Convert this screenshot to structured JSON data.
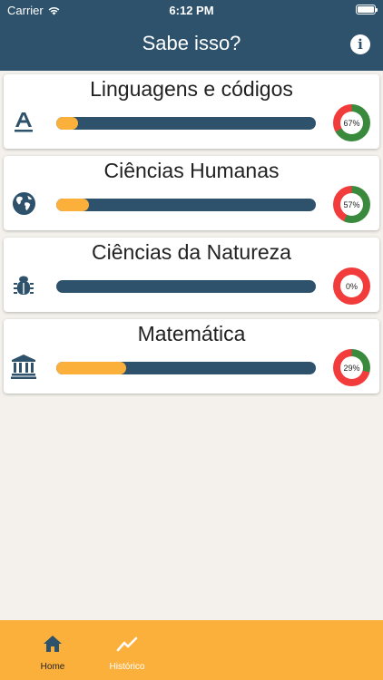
{
  "status_bar": {
    "carrier": "Carrier",
    "time": "6:12 PM"
  },
  "nav": {
    "title": "Sabe isso?",
    "info_icon": "info-icon"
  },
  "subjects": [
    {
      "title": "Linguagens e códigos",
      "icon": "font-icon",
      "progress": 0.085,
      "score_label": "67%",
      "score": 67
    },
    {
      "title": "Ciências Humanas",
      "icon": "globe-icon",
      "progress": 0.125,
      "score_label": "57%",
      "score": 57
    },
    {
      "title": "Ciências da Natureza",
      "icon": "bug-icon",
      "progress": 0.0,
      "score_label": "0%",
      "score": 0
    },
    {
      "title": "Matemática",
      "icon": "bank-icon",
      "progress": 0.27,
      "score_label": "29%",
      "score": 29
    }
  ],
  "tabs": [
    {
      "label": "Home",
      "icon": "home-icon",
      "active": true
    },
    {
      "label": "Histórico",
      "icon": "trend-icon",
      "active": false
    }
  ],
  "colors": {
    "primary": "#2e526c",
    "accent": "#fbb03b",
    "score_good": "#3a8a3d",
    "score_bad": "#f23b3b",
    "background": "#f4f1ec"
  }
}
